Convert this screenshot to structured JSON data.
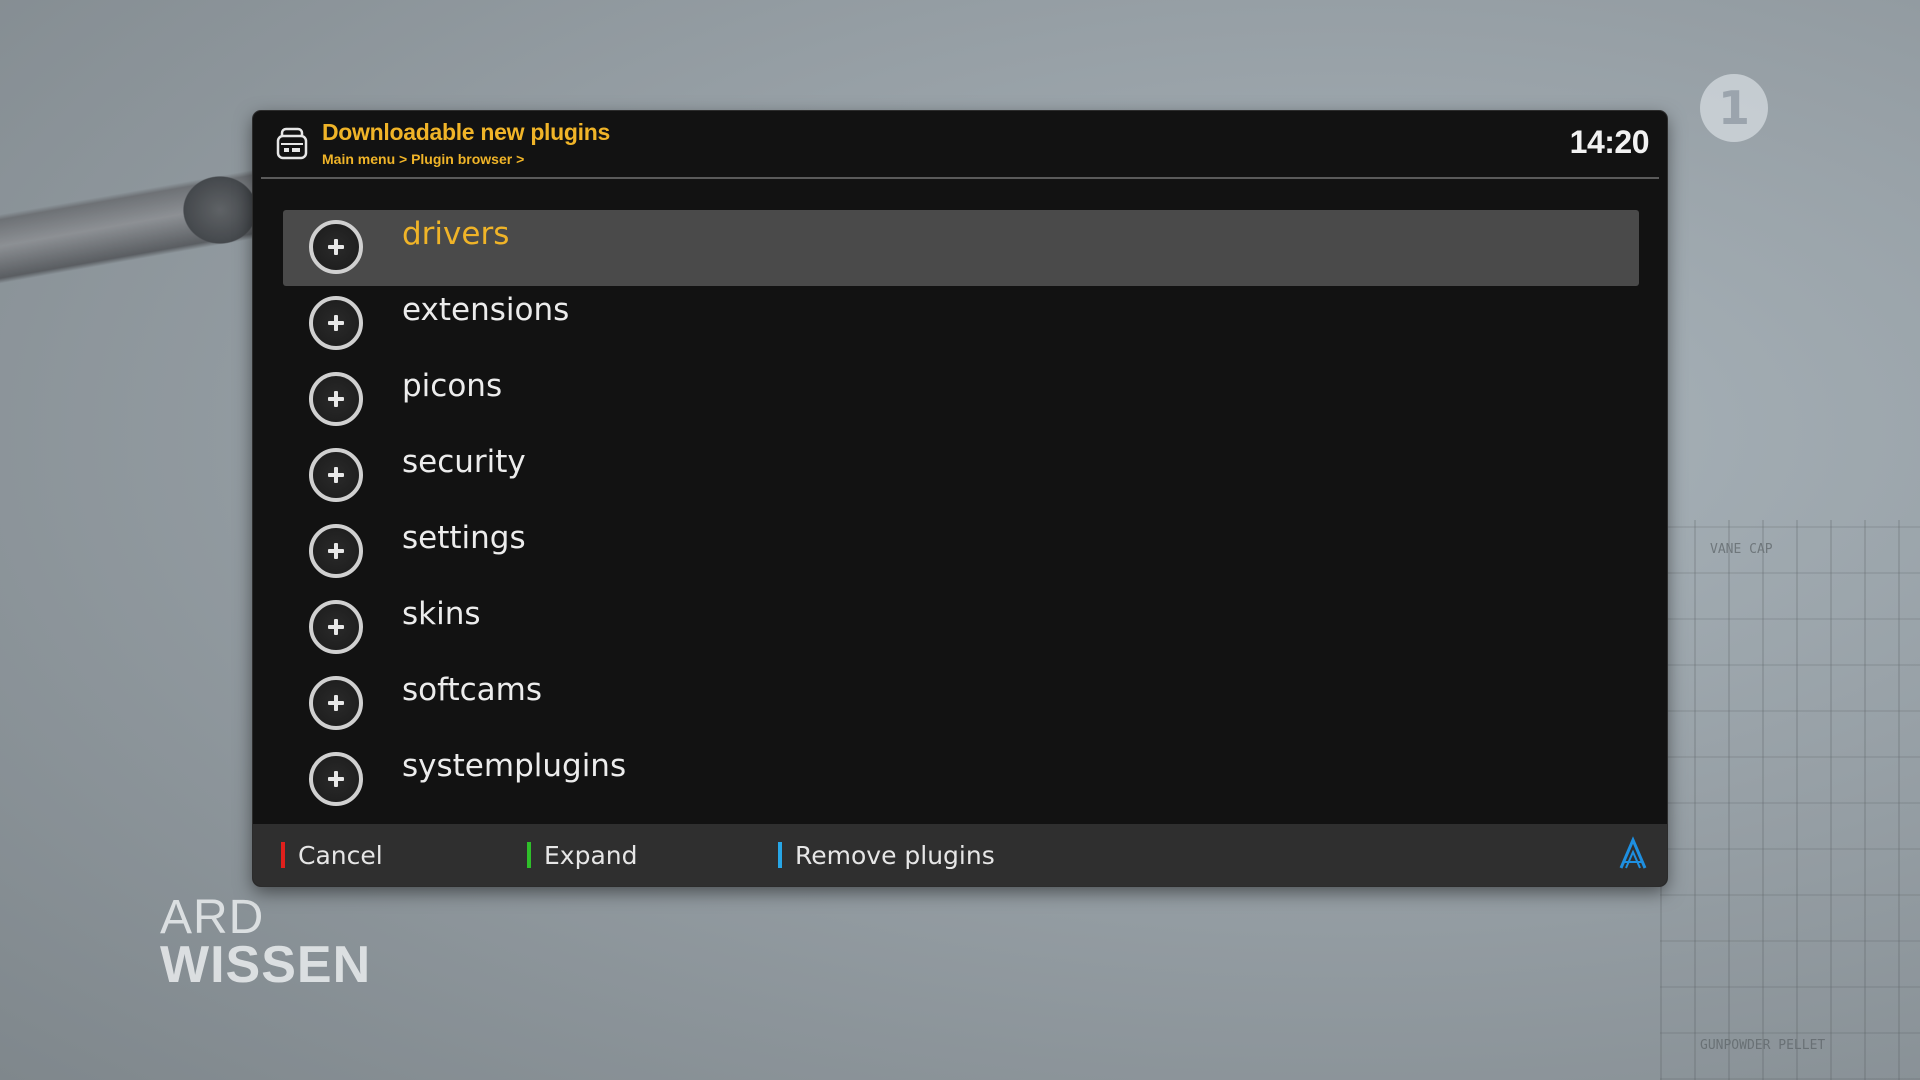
{
  "screen": {
    "title": "Downloadable new plugins",
    "breadcrumb": "Main menu > Plugin browser >",
    "clock": "14:20"
  },
  "background": {
    "channel_logo_text": "1",
    "ard_logo_line1": "ARD",
    "ard_logo_line2": "WISSEN",
    "diagram_labels": [
      "VANE CAP",
      "GUNPOWDER PELLET"
    ]
  },
  "categories": [
    {
      "label": "drivers",
      "selected": true
    },
    {
      "label": "extensions",
      "selected": false
    },
    {
      "label": "picons",
      "selected": false
    },
    {
      "label": "security",
      "selected": false
    },
    {
      "label": "settings",
      "selected": false
    },
    {
      "label": "skins",
      "selected": false
    },
    {
      "label": "softcams",
      "selected": false
    },
    {
      "label": "systemplugins",
      "selected": false
    }
  ],
  "footer": {
    "red": {
      "label": "Cancel",
      "color": "#e0201c"
    },
    "green": {
      "label": "Expand",
      "color": "#2fbf2a"
    },
    "blue": {
      "label": "Remove plugins",
      "color": "#27a6e6"
    }
  },
  "colors": {
    "accent": "#f0b428",
    "selection": "#4a4a4a",
    "panel": "#121212"
  },
  "icons": {
    "header": "plugin-browser-icon",
    "item": "plus-circle-icon",
    "footer_logo": "openatv-logo-icon"
  }
}
